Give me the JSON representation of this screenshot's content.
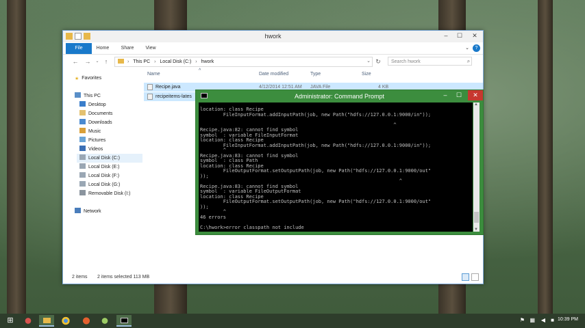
{
  "explorer": {
    "title": "hwork",
    "ribbon_tabs": [
      "File",
      "Home",
      "Share",
      "View"
    ],
    "address": {
      "segments": [
        "This PC",
        "Local Disk (C:)",
        "hwork"
      ]
    },
    "search_placeholder": "Search hwork",
    "nav": {
      "favorites": "Favorites",
      "this_pc": "This PC",
      "pc_items": [
        "Desktop",
        "Documents",
        "Downloads",
        "Music",
        "Pictures",
        "Videos",
        "Local Disk (C:)",
        "Local Disk (E:)",
        "Local Disk (F:)",
        "Local Disk (G:)",
        "Removable Disk (I:)"
      ],
      "network": "Network"
    },
    "columns": {
      "name": "Name",
      "date": "Date modified",
      "type": "Type",
      "size": "Size"
    },
    "files": [
      {
        "name": "Recipe.java",
        "date": "4/12/2014 12:51 AM",
        "type": "JAVA File",
        "size": "4 KB"
      },
      {
        "name": "recipeitems-lates",
        "date": "",
        "type": "",
        "size": ""
      }
    ],
    "status": {
      "items": "2 items",
      "selected": "2 items selected  113 MB"
    }
  },
  "cmd": {
    "title": "Administrator: Command Prompt",
    "lines": [
      "location: class Recipe",
      "        FileInputFormat.addInputPath(job, new Path(\"hdfs://127.0.0.1:9000/in\"));",
      "",
      "                                                                   ^",
      "Recipe.java:82: cannot find symbol",
      "symbol  : variable FileInputFormat",
      "location: class Recipe",
      "        FileInputFormat.addInputPath(job, new Path(\"hdfs://127.0.0.1:9000/in\"));",
      "        ^",
      "Recipe.java:83: cannot find symbol",
      "symbol  : class Path",
      "location: class Recipe",
      "        FileOutputFormat.setOutputPath(job, new Path(\"hdfs://127.0.0.1:9000/out\"",
      "));",
      "                                                                     ^",
      "Recipe.java:83: cannot find symbol",
      "symbol  : variable FileOutputFormat",
      "location: class Recipe",
      "        FileOutputFormat.setOutputPath(job, new Path(\"hdfs://127.0.0.1:9000/out\"",
      "));",
      "        ^",
      "46 errors",
      "",
      "C:\\hwork>error classpath not include"
    ]
  },
  "taskbar": {
    "clock": "10:39 PM"
  },
  "colors": {
    "cmd_frame": "#3c8d3e",
    "ribbon_file": "#1979ca"
  }
}
